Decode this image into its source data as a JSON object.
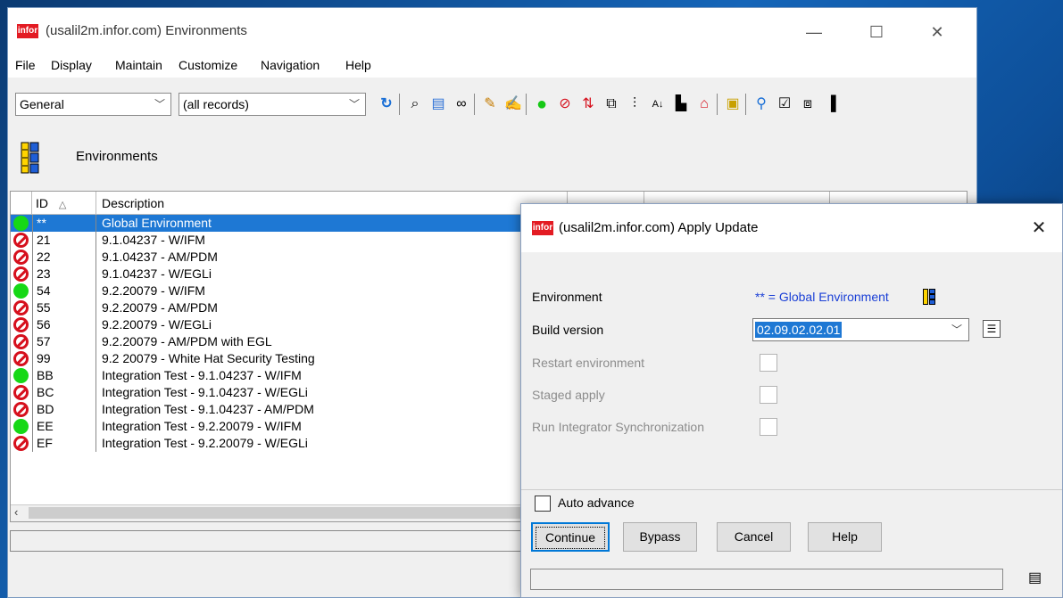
{
  "main": {
    "logo_text": "infor",
    "title": "(usalil2m.infor.com) Environments",
    "menu": [
      "File",
      "Display",
      "Maintain",
      "Customize",
      "Navigation",
      "Help"
    ],
    "view_combo": "General",
    "filter_combo": "(all records)",
    "section_label": "Environments",
    "columns": {
      "id": "ID",
      "description": "Description"
    },
    "rows": [
      {
        "status": "green",
        "id": "**",
        "description": "Global Environment",
        "selected": true
      },
      {
        "status": "red",
        "id": "21",
        "description": "9.1.04237 - W/IFM"
      },
      {
        "status": "red",
        "id": "22",
        "description": "9.1.04237 - AM/PDM"
      },
      {
        "status": "red",
        "id": "23",
        "description": "9.1.04237 - W/EGLi"
      },
      {
        "status": "green",
        "id": "54",
        "description": "9.2.20079 - W/IFM"
      },
      {
        "status": "red",
        "id": "55",
        "description": "9.2.20079 - AM/PDM"
      },
      {
        "status": "red",
        "id": "56",
        "description": "9.2.20079 - W/EGLi"
      },
      {
        "status": "red",
        "id": "57",
        "description": "9.2.20079 - AM/PDM with EGL"
      },
      {
        "status": "red",
        "id": "99",
        "description": "9.2 20079 - White Hat Security Testing"
      },
      {
        "status": "green",
        "id": "BB",
        "description": "Integration Test - 9.1.04237 - W/IFM"
      },
      {
        "status": "red",
        "id": "BC",
        "description": "Integration Test - 9.1.04237 - W/EGLi"
      },
      {
        "status": "red",
        "id": "BD",
        "description": "Integration Test - 9.1.04237 - AM/PDM"
      },
      {
        "status": "green",
        "id": "EE",
        "description": "Integration Test - 9.2.20079 - W/IFM"
      },
      {
        "status": "red",
        "id": "EF",
        "description": "Integration Test - 9.2.20079 - W/EGLi"
      }
    ]
  },
  "dialog": {
    "logo_text": "infor",
    "title": "(usalil2m.infor.com) Apply Update",
    "environment_label": "Environment",
    "environment_value": "** = Global Environment",
    "build_version_label": "Build version",
    "build_version_value": "02.09.02.02.01",
    "restart_label": "Restart environment",
    "staged_label": "Staged apply",
    "run_sync_label": "Run Integrator Synchronization",
    "auto_advance_label": "Auto advance",
    "buttons": {
      "continue": "Continue",
      "bypass": "Bypass",
      "cancel": "Cancel",
      "help": "Help"
    }
  },
  "colors": {
    "status_ok": "#16d816",
    "status_blocked": "#d6101d",
    "selection": "#1e78d4",
    "infor_red": "#e31b23",
    "link_blue": "#1a3fd6"
  }
}
